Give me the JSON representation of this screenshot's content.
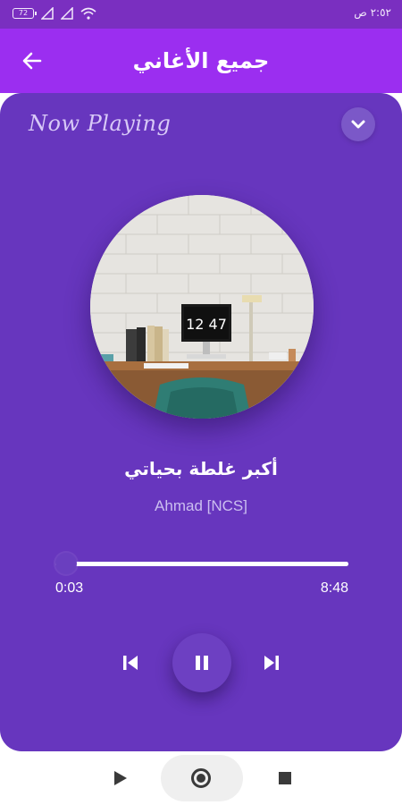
{
  "status_bar": {
    "time": "٢:٥٢ ص",
    "battery": "72",
    "icons": [
      "battery-icon",
      "signal-icon",
      "signal-icon",
      "wifi-icon"
    ]
  },
  "app_bar": {
    "title": "جميع الأغاني",
    "back_icon": "arrow-left-icon"
  },
  "player": {
    "header": "Now Playing",
    "collapse_icon": "chevron-down-icon",
    "album_art": "desk-workspace-image",
    "clock_text": "12 47",
    "song_title": "أكبر غلطة بحياتي",
    "artist": "Ahmad [NCS]",
    "progress": {
      "elapsed": "0:03",
      "total": "8:48",
      "fraction": 0.006
    },
    "controls": {
      "previous_icon": "skip-previous-icon",
      "play_pause_icon": "pause-icon",
      "next_icon": "skip-next-icon"
    }
  },
  "nav_bar": {
    "back_icon": "nav-back-icon",
    "home_icon": "nav-home-icon",
    "recents_icon": "nav-recents-icon"
  },
  "colors": {
    "status_bar": "#7a2fc0",
    "app_bar": "#9b2ef0",
    "card": "#6736be",
    "accent_white": "#ffffff"
  }
}
